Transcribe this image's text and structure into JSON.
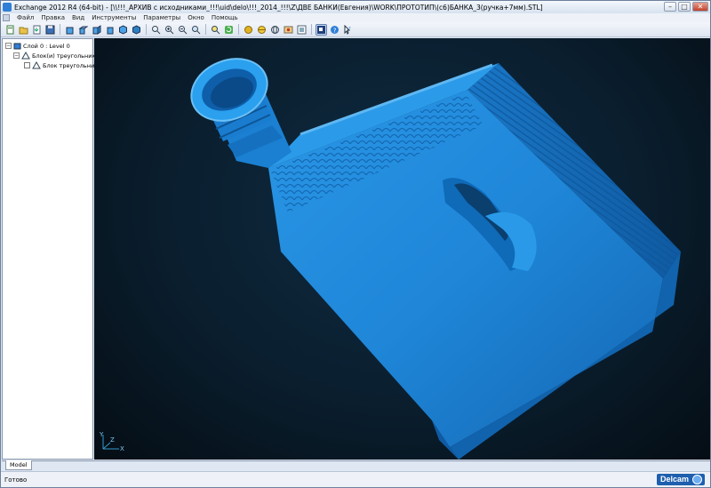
{
  "window": {
    "title": "Exchange 2012 R4 (64-bit) - [\\\\!!!_АРХИВ с исходниками_!!!\\uid\\delo\\!!!_2014_!!!\\Z\\ДВЕ БАНКИ(Евгения)\\WORK\\ПРОТОТИП\\(с6)БАНКА_3(ручка+7мм).STL]",
    "minimize": "–",
    "maximize": "□",
    "close": "✕"
  },
  "menu": [
    "Файл",
    "Правка",
    "Вид",
    "Инструменты",
    "Параметры",
    "Окно",
    "Помощь"
  ],
  "tree": {
    "root": "Слой 0 : Level 0",
    "child": "Блок(и) треугольников",
    "leaf": "Блок треугольников"
  },
  "tabs": {
    "model": "Model"
  },
  "status": {
    "text": "Готово"
  },
  "brand": {
    "name": "Delcam"
  },
  "colors": {
    "model": "#1f86d8",
    "viewport": "#0a1e2e",
    "brand": "#1e5fae"
  },
  "axis": {
    "x": "X",
    "y": "Y",
    "z": "Z"
  }
}
